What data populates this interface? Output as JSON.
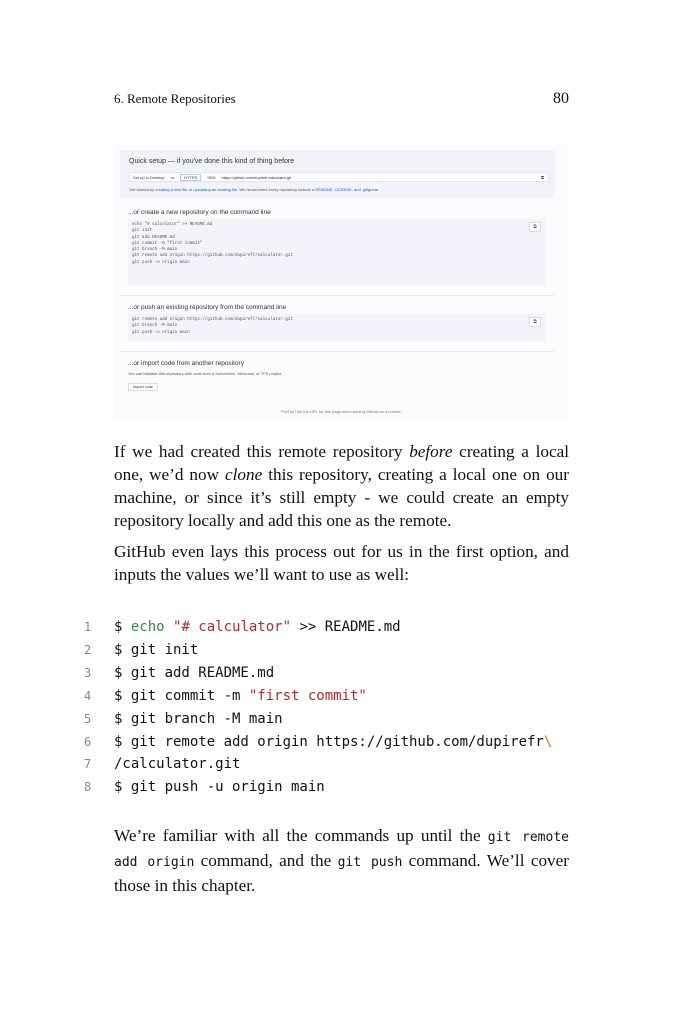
{
  "header": {
    "chapter": "6. Remote Repositories",
    "page_number": "80"
  },
  "screenshot": {
    "quick_setup_title": "Quick setup — if you've done this kind of thing before",
    "setup_desktop": "Set up in Desktop",
    "or": "or",
    "https": "HTTPS",
    "ssh": "SSH",
    "url": "https://github.com/dupirefr/calculator.git",
    "note_prefix": "Get started by",
    "note_link1": "creating a new file",
    "note_mid": "or",
    "note_link2": "uploading an existing file",
    "note_rest": ". We recommend every repository include a",
    "note_links": "README, LICENSE, and .gitignore.",
    "section_new": "...or create a new repository on the command line",
    "code_new": "echo \"# calculator\" >> README.md\ngit init\ngit add README.md\ngit commit -m \"first commit\"\ngit branch -M main\ngit remote add origin https://github.com/dupirefr/calculator.git\ngit push -u origin main",
    "section_push": "...or push an existing repository from the command line",
    "code_push": "git remote add origin https://github.com/dupirefr/calculator.git\ngit branch -M main\ngit push -u origin main",
    "section_import": "...or import code from another repository",
    "import_desc": "You can initialize this repository with code from a Subversion, Mercurial, or TFS project.",
    "import_button": "Import code",
    "protip": "ProTip! Use the URL for this page when adding GitHub as a remote."
  },
  "para1": {
    "a": "If we had created this remote repository ",
    "em1": "before",
    "b": " creating a local one, we’d now ",
    "em2": "clone",
    "c": " this repository, creating a local one on our machine, or since it’s still empty - we could create an empty repository locally and add this one as the remote."
  },
  "para2": "GitHub even lays this process out for us in the first option, and inputs the values we’ll want to use as well:",
  "code": [
    {
      "n": "1",
      "parts": [
        {
          "t": "$ ",
          "c": ""
        },
        {
          "t": "echo",
          "c": "kw"
        },
        {
          "t": " ",
          "c": ""
        },
        {
          "t": "\"# calculator\"",
          "c": "str"
        },
        {
          "t": " >> README.md",
          "c": ""
        }
      ]
    },
    {
      "n": "2",
      "parts": [
        {
          "t": "$ git init",
          "c": ""
        }
      ]
    },
    {
      "n": "3",
      "parts": [
        {
          "t": "$ git add README.md",
          "c": ""
        }
      ]
    },
    {
      "n": "4",
      "parts": [
        {
          "t": "$ git commit -m ",
          "c": ""
        },
        {
          "t": "\"first commit\"",
          "c": "str"
        }
      ]
    },
    {
      "n": "5",
      "parts": [
        {
          "t": "$ git branch -M main",
          "c": ""
        }
      ]
    },
    {
      "n": "6",
      "parts": [
        {
          "t": "$ git remote add origin https://github.com/dupirefr",
          "c": ""
        },
        {
          "t": "\\",
          "c": "esc"
        }
      ]
    },
    {
      "n": "7",
      "parts": [
        {
          "t": "/calculator.git",
          "c": ""
        }
      ]
    },
    {
      "n": "8",
      "parts": [
        {
          "t": "$ git push -u origin main",
          "c": ""
        }
      ]
    }
  ],
  "para3": {
    "a": "We’re familiar with all the commands up until the ",
    "code1": "git remote add origin",
    "b": " command, and the ",
    "code2": "git push",
    "c": " command. We’ll cover those in this chapter."
  },
  "colors": {
    "keyword": "#3a8a3a",
    "string": "#b22a2a",
    "escape": "#d07a00",
    "link": "#0366d6"
  }
}
